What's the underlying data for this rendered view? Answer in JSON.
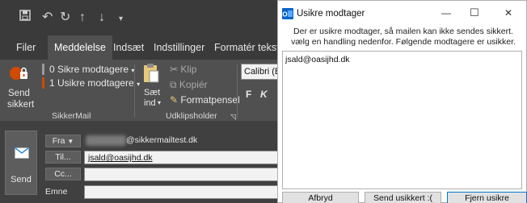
{
  "ribbon": {
    "tabs": [
      "Filer",
      "Meddelelse",
      "Indsæt",
      "Indstillinger",
      "Formatér tekst"
    ],
    "sikker_send_label_1": "Send",
    "sikker_send_label_2": "sikkert",
    "sikre_modtagere": "0 Sikre modtagere",
    "usikre_modtagere": "1 Usikre modtagere",
    "group_sikkermail": "SikkerMail",
    "klip": "Klip",
    "kopier": "Kopiér",
    "saet_ind_1": "Sæt",
    "saet_ind_2": "ind",
    "formatpensel": "Formatpensel",
    "group_udklip": "Udklipsholder",
    "font_name": "Calibri (B",
    "bold": "F",
    "italic": "K"
  },
  "compose": {
    "send_label": "Send",
    "fra_label": "Fra",
    "fra_value": "@sikkermailtest.dk",
    "til_label": "Til...",
    "til_value": "jsald@oasijhd.dk",
    "cc_label": "Cc...",
    "emne_label": "Emne"
  },
  "dialog": {
    "title": "Usikre modtager",
    "message": "Der er usikre modtager, så mailen kan ikke sendes sikkert. vælg en handling nedenfor. Følgende modtagere er usikker.",
    "recipients": [
      "jsald@oasijhd.dk"
    ],
    "buttons": {
      "cancel": "Afbryd",
      "send_unsafe": "Send usikkert :(",
      "remove_unsafe": "Fjern usikre modtager :)"
    },
    "minimize_glyph": "—",
    "maximize_glyph": "☐",
    "close_glyph": "✕"
  },
  "colors": {
    "outlook_dark": "#2b2b2b",
    "ribbon_bg": "#505050",
    "outlook_orange": "#d04a02",
    "accent_blue": "#0078d7"
  }
}
